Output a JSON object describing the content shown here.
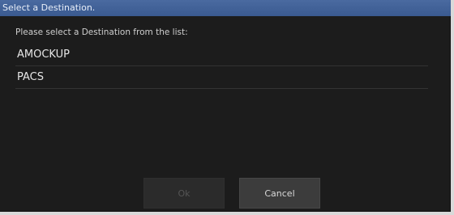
{
  "window": {
    "title": "Select a Destination."
  },
  "prompt": "Please select a Destination from the list:",
  "destinations": [
    {
      "label": "AMOCKUP"
    },
    {
      "label": "PACS"
    }
  ],
  "buttons": {
    "ok_label": "Ok",
    "ok_enabled": false,
    "cancel_label": "Cancel"
  },
  "colors": {
    "titlebar": "#3d5d93",
    "background": "#1c1c1c",
    "button": "#3c3c3c"
  }
}
